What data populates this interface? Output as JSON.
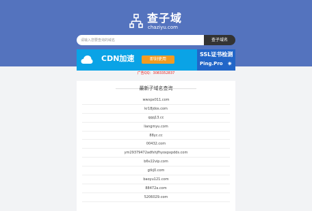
{
  "site": {
    "title": "查子域",
    "subtitle": "chaziyu.com",
    "icon": "sitemap-icon"
  },
  "search": {
    "placeholder": "请输入您要查询的域名",
    "button_label": "查子域名"
  },
  "ad": {
    "cdn_text": "CDN加速",
    "cdn_button": "即刻使用",
    "ssl_title": "SSL证书检测",
    "ssl_brand": "Ping.Pro",
    "colors": {
      "cdn_bg": "#0aa3e6",
      "cdn_button": "#f29b21",
      "ssl_bg": "#2266c8"
    }
  },
  "contact": "广告QQ：3083352837",
  "latest": {
    "title": "最新子域名查询",
    "domains": [
      "wwxpx011.com",
      "kr18jdos.com",
      "qqq13.cc",
      "liangmyu.com",
      "88yc.cc",
      "00432.com",
      "ym29379472adfshjfhyoxpxpdds.com",
      "b6v22vip.com",
      "gtkj0.com",
      "baoyu121.com",
      "88472a.com",
      "5206029.com"
    ]
  },
  "colors": {
    "hero_bg": "#5473be",
    "page_bg": "#f2f3f5",
    "button_bg": "#333333",
    "contact_text": "#e02020"
  }
}
